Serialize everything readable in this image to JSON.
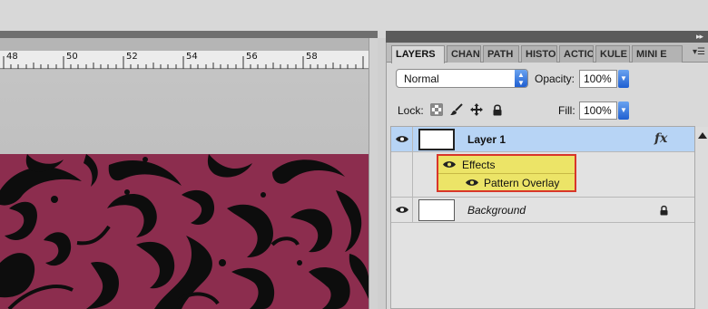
{
  "ruler": {
    "ticks": [
      "48",
      "50",
      "52",
      "54",
      "56",
      "58"
    ]
  },
  "panel": {
    "tabs": [
      "LAYERS",
      "CHAN",
      "PATH",
      "HISTO",
      "ACTIO",
      "KULE",
      "MINI E"
    ],
    "blend_mode": "Normal",
    "opacity_label": "Opacity:",
    "opacity_value": "100%",
    "lock_label": "Lock:",
    "fill_label": "Fill:",
    "fill_value": "100%",
    "layers": [
      {
        "name": "Layer 1",
        "has_fx": true,
        "fx_label": "fx",
        "selected": true
      },
      {
        "name": "Background",
        "italic": true,
        "locked": true
      }
    ],
    "effects": {
      "group_label": "Effects",
      "items": [
        "Pattern Overlay"
      ]
    }
  },
  "colors": {
    "canvas_fill": "#8c2d4e",
    "pattern": "#0d0d0d",
    "selection": "#b7d4f5",
    "effects_highlight": "#ece467",
    "effects_border": "#d8362a",
    "accent_blue": "#1f5fd1"
  },
  "icons": [
    "eye-icon",
    "lock-transparent-icon",
    "lock-paint-icon",
    "lock-move-icon",
    "lock-all-icon",
    "fx-icon",
    "lock-icon",
    "panel-menu-icon",
    "scroll-up-icon",
    "collapse-icon"
  ]
}
